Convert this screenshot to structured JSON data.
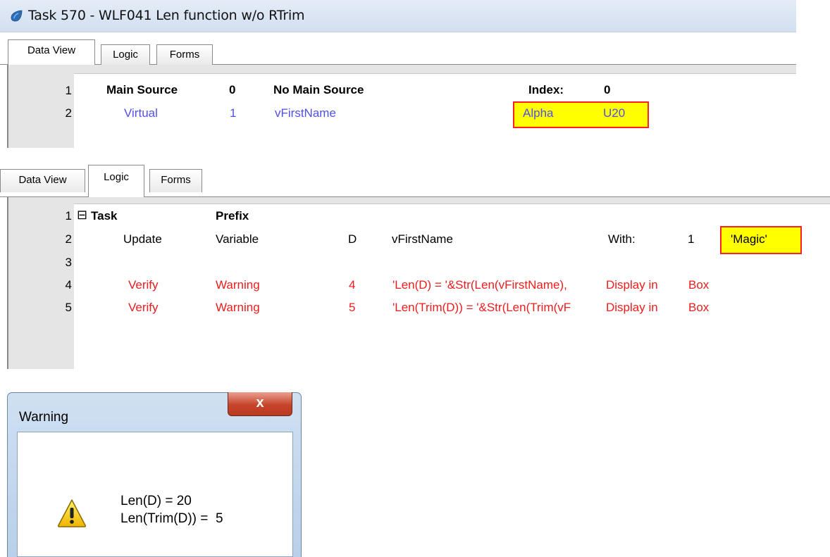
{
  "panel1": {
    "title": "Task 570 -   WLF041 Len function w/o RTrim",
    "tabs": [
      "Data View",
      "Logic",
      "Forms"
    ],
    "rows": [
      {
        "num": "1",
        "c1": "Main Source",
        "c2": "0",
        "c3": "No Main Source",
        "c4": "Index:",
        "c5": "0"
      },
      {
        "num": "2",
        "c1": "Virtual",
        "c2": "1",
        "c3": "vFirstName",
        "c4": "Alpha",
        "c5": "U20"
      }
    ]
  },
  "panel2": {
    "tabs": [
      "Data View",
      "Logic",
      "Forms"
    ],
    "expander": "⊟",
    "rows": [
      {
        "num": "1",
        "c1": "Task",
        "c2": "Prefix"
      },
      {
        "num": "2",
        "c1": "Update",
        "c2": "Variable",
        "c3": "D",
        "c4": "vFirstName",
        "c5": "With:",
        "c6": "1",
        "c7": "'Magic'"
      },
      {
        "num": "3"
      },
      {
        "num": "4",
        "c1": "Verify",
        "c2": "Warning",
        "c3": "4",
        "c4": "'Len(D) = '&Str(Len(vFirstName),",
        "c5": "Display in",
        "c6": "Box"
      },
      {
        "num": "5",
        "c1": "Verify",
        "c2": "Warning",
        "c3": "5",
        "c4": "'Len(Trim(D)) = '&Str(Len(Trim(vF",
        "c5": "Display in",
        "c6": "Box"
      }
    ]
  },
  "dialog": {
    "title": "Warning",
    "close": "x",
    "line1": "Len(D) = 20",
    "line2": "Len(Trim(D)) =  5",
    "icon": "warning-icon"
  },
  "colors": {
    "highlight": "#ffff00",
    "highlight_border": "#ff2020",
    "blue_text": "#5050e6",
    "red_text": "#ee1c1c"
  }
}
